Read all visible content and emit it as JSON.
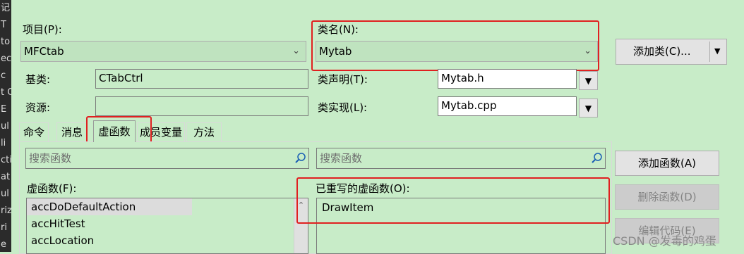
{
  "left_strip": [
    "记",
    "T",
    "to",
    "ec",
    "c",
    "t C",
    "E",
    "ul",
    "li",
    "cti",
    "at",
    "ul",
    "riz",
    "ri",
    "e"
  ],
  "project": {
    "label": "项目(P):",
    "value": "MFCtab"
  },
  "classname": {
    "label": "类名(N):",
    "value": "Mytab"
  },
  "add_class_button": "添加类(C)...",
  "base_class": {
    "label": "基类:",
    "value": "CTabCtrl"
  },
  "resource": {
    "label": "资源:",
    "value": ""
  },
  "class_decl": {
    "label": "类声明(T):",
    "value": "Mytab.h"
  },
  "class_impl": {
    "label": "类实现(L):",
    "value": "Mytab.cpp"
  },
  "tabs": [
    "命令",
    "消息",
    "虚函数",
    "成员变量",
    "方法"
  ],
  "search_left_placeholder": "搜索函数",
  "search_right_placeholder": "搜索函数",
  "virtual_functions": {
    "label": "虚函数(F):",
    "items": [
      "accDoDefaultAction",
      "accHitTest",
      "accLocation"
    ]
  },
  "overridden": {
    "label": "已重写的虚函数(O):",
    "items": [
      "DrawItem"
    ]
  },
  "buttons": {
    "add_function": "添加函数(A)",
    "delete_function": "删除函数(D)",
    "edit_code": "编辑代码(E)"
  },
  "watermark": "CSDN @发毒的鸡蛋"
}
